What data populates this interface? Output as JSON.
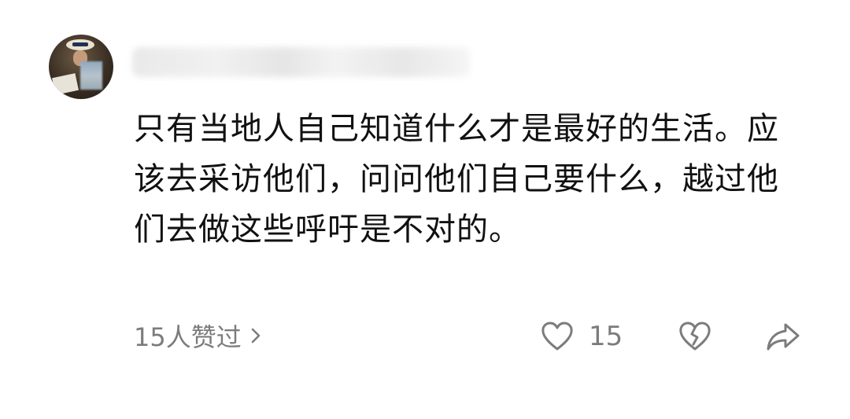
{
  "comment": {
    "author": {
      "name_redacted": true
    },
    "body": "只有当地人自己知道什么才是最好的生活。应该去采访他们，问问他们自己要什么，越过他们去做这些呼吁是不对的。",
    "likes_link": "15人赞过",
    "like_count": "15"
  },
  "icons": {
    "like": "heart-outline-icon",
    "dislike": "broken-heart-icon",
    "share": "share-arrow-icon",
    "more": "chevron-right-icon"
  },
  "colors": {
    "text": "#111111",
    "secondary": "#7c7c7c",
    "background": "#ffffff"
  }
}
